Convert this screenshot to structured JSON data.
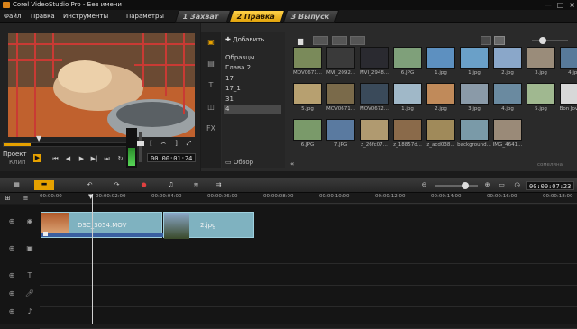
{
  "window": {
    "title": "Corel VideoStudio Pro - Без имени",
    "controls": [
      "—",
      "□",
      "×"
    ]
  },
  "menu": [
    "Файл",
    "Правка",
    "Инструменты",
    "Параметры"
  ],
  "steps": [
    {
      "label": "1 Захват",
      "active": false
    },
    {
      "label": "2 Правка",
      "active": true
    },
    {
      "label": "3 Выпуск",
      "active": false
    }
  ],
  "player": {
    "mode_project": "Проект",
    "mode_clip": "Клип",
    "timecode": "00:00:01:24",
    "progress": 0.2
  },
  "library": {
    "add_label": "Добавить",
    "folders": [
      "Образцы",
      "Глава 2",
      "17",
      "17_1",
      "31",
      "4"
    ],
    "selected_folder": "4",
    "browse_label": "Обзор",
    "partial_label": "сомелина",
    "thumbs": [
      {
        "label": "MOV0671...",
        "color": "#7a8a5a"
      },
      {
        "label": "MVI_2092...",
        "color": "#3a3a3a"
      },
      {
        "label": "MVI_2948...",
        "color": "#2a2a30"
      },
      {
        "label": "6.JPG",
        "color": "#7fa07a"
      },
      {
        "label": "1.jpg",
        "color": "#5d90c0"
      },
      {
        "label": "1.jpg",
        "color": "#6aa0c8"
      },
      {
        "label": "2.jpg",
        "color": "#8aa7c9"
      },
      {
        "label": "3.jpg",
        "color": "#9a8c7a"
      },
      {
        "label": "4.jpg",
        "color": "#587a9a"
      },
      {
        "label": "5.jpg",
        "color": "#b7a070"
      },
      {
        "label": "MOV0671...",
        "color": "#7a6a4a"
      },
      {
        "label": "MOV0672...",
        "color": "#3a4a5a"
      },
      {
        "label": "1.jpg",
        "color": "#a0b8c8"
      },
      {
        "label": "2.jpg",
        "color": "#c08a5a"
      },
      {
        "label": "3.jpg",
        "color": "#8a9aa8"
      },
      {
        "label": "4.jpg",
        "color": "#6a8aa0"
      },
      {
        "label": "5.jpg",
        "color": "#a0b890"
      },
      {
        "label": "Bon Jovi - ...",
        "color": "#d8d8d8"
      },
      {
        "label": "6.JPG",
        "color": "#7a9a6a"
      },
      {
        "label": "7.JPG",
        "color": "#5a7aa0"
      },
      {
        "label": "z_26fc07...",
        "color": "#b09a70"
      },
      {
        "label": "z_18857d...",
        "color": "#8a6a4a"
      },
      {
        "label": "z_acd038...",
        "color": "#a08a5a"
      },
      {
        "label": "background...",
        "color": "#7a9aa8"
      },
      {
        "label": "IMG_4641...",
        "color": "#9a8a78"
      }
    ]
  },
  "timeline": {
    "timecode": "00:00:07:23",
    "ruler": [
      "00:00:00",
      "00:00:02:00",
      "00:00:04:00",
      "00:00:06:00",
      "00:00:08:00",
      "00:00:10:00",
      "00:00:12:00",
      "00:00:14:00",
      "00:00:16:00",
      "00:00:18:00"
    ],
    "clips": [
      {
        "label": "DSC_3054.MOV"
      },
      {
        "label": "2.jpg"
      }
    ]
  }
}
